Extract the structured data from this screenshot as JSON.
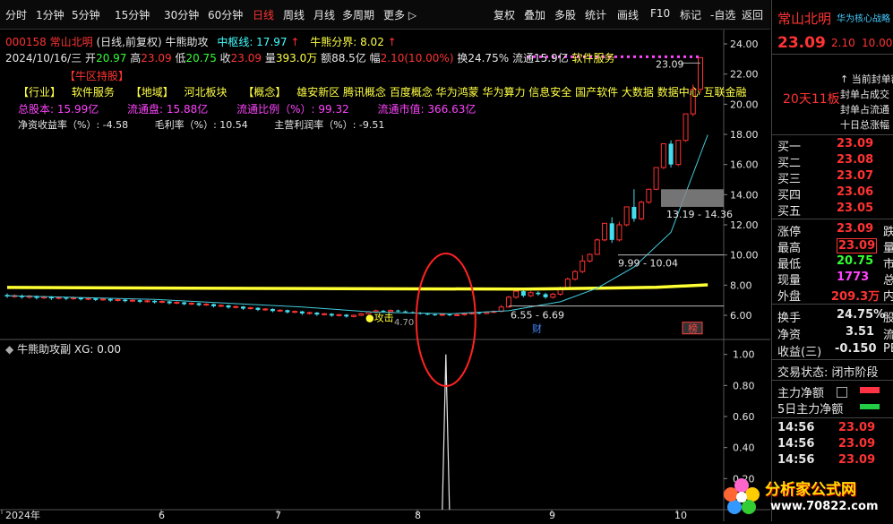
{
  "toolbar": {
    "left_items": [
      "分时",
      "1分钟",
      "5分钟",
      "15分钟",
      "30分钟",
      "60分钟",
      "日线",
      "周线",
      "月线",
      "多周期",
      "更多"
    ],
    "active": "日线",
    "right_items": [
      "复权",
      "叠加",
      "多股",
      "统计",
      "画线",
      "F10",
      "标记",
      "-自选",
      "返回"
    ]
  },
  "info": {
    "code_name": "000158 常山北明",
    "fq": "(日线,前复权)",
    "indicator": "牛熊助攻",
    "pivot_label": "中枢线: 17.97",
    "bull_bear": "牛熊分界: 8.02",
    "date": "2024/10/16/三",
    "open_label": "开",
    "open": "20.97",
    "high_label": "高",
    "high": "23.09",
    "low_label": "低",
    "low": "20.75",
    "close_label": "收",
    "close": "23.09",
    "vol_label": "量",
    "vol": "393.0万",
    "amt_label": "额",
    "amt": "88.5亿",
    "amp_label": "幅",
    "amp": "2.10(10.00%)",
    "turn_label": "换",
    "turn": "24.75%",
    "float_label": "流通",
    "float": "15.9亿",
    "sector": "软件服务"
  },
  "annot": {
    "zone": "【牛区持股】",
    "industry_tag": "【行业】",
    "industry": "软件服务",
    "region_tag": "【地域】",
    "region": "河北板块",
    "concept_tag": "【概念】",
    "concepts": "雄安新区 腾讯概念 百度概念 华为鸿蒙 华为算力 信息安全 国产软件 大数据 数据中心 互联金融",
    "total_share": "总股本: 15.99亿",
    "float_share": "流通盘: 15.88亿",
    "float_ratio": "流通比例（%）: 99.32",
    "float_mv": "流通市值: 366.63亿",
    "roe": "净资收益率（%）: -4.58",
    "gross": "毛利率（%）: 10.54",
    "net": "主营利润率（%）: -9.51"
  },
  "chart_marks": {
    "last_price": "23.09",
    "range1": "13.19 - 14.36",
    "range2": "9.99 - 10.04",
    "range3": "6.55 - 6.69",
    "low_mark": "4.70",
    "fin": "财",
    "rank": "榜",
    "attack": "攻击"
  },
  "sub": {
    "title": "牛熊助攻副 XG: 0.00"
  },
  "chart_data": {
    "type": "line",
    "y_ticks": [
      "24.00",
      "22.00",
      "20.00",
      "18.00",
      "16.00",
      "14.00",
      "12.00",
      "10.00",
      "8.00",
      "6.00"
    ],
    "ylim": [
      5.2,
      24.8
    ],
    "sub_ticks": [
      "1.00",
      "0.80",
      "0.60",
      "0.40",
      "0.20"
    ],
    "sub_ylim": [
      0,
      1.05
    ],
    "x_ticks": [
      "2024年",
      "6",
      "7",
      "8",
      "9",
      "10"
    ],
    "candles": [
      {
        "o": 7.35,
        "c": 7.25,
        "h": 7.45,
        "l": 7.15
      },
      {
        "o": 7.25,
        "c": 7.3,
        "h": 7.4,
        "l": 7.15
      },
      {
        "o": 7.3,
        "c": 7.2,
        "h": 7.38,
        "l": 7.1
      },
      {
        "o": 7.2,
        "c": 7.28,
        "h": 7.35,
        "l": 7.1
      },
      {
        "o": 7.28,
        "c": 7.15,
        "h": 7.32,
        "l": 7.05
      },
      {
        "o": 7.15,
        "c": 7.22,
        "h": 7.3,
        "l": 7.08
      },
      {
        "o": 7.22,
        "c": 7.12,
        "h": 7.28,
        "l": 7.02
      },
      {
        "o": 7.12,
        "c": 7.18,
        "h": 7.26,
        "l": 7.05
      },
      {
        "o": 7.18,
        "c": 7.1,
        "h": 7.22,
        "l": 7.0
      },
      {
        "o": 7.1,
        "c": 7.16,
        "h": 7.24,
        "l": 7.02
      },
      {
        "o": 7.16,
        "c": 7.06,
        "h": 7.2,
        "l": 6.98
      },
      {
        "o": 7.06,
        "c": 7.12,
        "h": 7.2,
        "l": 7.0
      },
      {
        "o": 7.12,
        "c": 7.02,
        "h": 7.16,
        "l": 6.94
      },
      {
        "o": 7.02,
        "c": 7.08,
        "h": 7.15,
        "l": 6.96
      },
      {
        "o": 7.08,
        "c": 6.98,
        "h": 7.12,
        "l": 6.9
      },
      {
        "o": 6.98,
        "c": 7.04,
        "h": 7.1,
        "l": 6.92
      },
      {
        "o": 7.04,
        "c": 6.94,
        "h": 7.08,
        "l": 6.86
      },
      {
        "o": 6.94,
        "c": 7.0,
        "h": 7.06,
        "l": 6.88
      },
      {
        "o": 7.0,
        "c": 6.9,
        "h": 7.04,
        "l": 6.82
      },
      {
        "o": 6.9,
        "c": 6.96,
        "h": 7.02,
        "l": 6.84
      },
      {
        "o": 6.96,
        "c": 6.86,
        "h": 7.0,
        "l": 6.78
      },
      {
        "o": 6.86,
        "c": 6.92,
        "h": 6.98,
        "l": 6.8
      },
      {
        "o": 6.92,
        "c": 6.8,
        "h": 6.95,
        "l": 6.72
      },
      {
        "o": 6.8,
        "c": 6.86,
        "h": 6.92,
        "l": 6.74
      },
      {
        "o": 6.86,
        "c": 6.74,
        "h": 6.9,
        "l": 6.66
      },
      {
        "o": 6.74,
        "c": 6.8,
        "h": 6.86,
        "l": 6.68
      },
      {
        "o": 6.8,
        "c": 6.68,
        "h": 6.84,
        "l": 6.6
      },
      {
        "o": 6.68,
        "c": 6.74,
        "h": 6.8,
        "l": 6.62
      },
      {
        "o": 6.74,
        "c": 6.6,
        "h": 6.78,
        "l": 6.52
      },
      {
        "o": 6.6,
        "c": 6.66,
        "h": 6.72,
        "l": 6.54
      },
      {
        "o": 6.66,
        "c": 6.52,
        "h": 6.7,
        "l": 6.44
      },
      {
        "o": 6.52,
        "c": 6.58,
        "h": 6.64,
        "l": 6.46
      },
      {
        "o": 6.58,
        "c": 6.44,
        "h": 6.62,
        "l": 6.36
      },
      {
        "o": 6.44,
        "c": 6.5,
        "h": 6.56,
        "l": 6.38
      },
      {
        "o": 6.5,
        "c": 6.36,
        "h": 6.54,
        "l": 6.28
      },
      {
        "o": 6.36,
        "c": 6.42,
        "h": 6.48,
        "l": 6.3
      },
      {
        "o": 6.42,
        "c": 6.28,
        "h": 6.46,
        "l": 6.2
      },
      {
        "o": 6.28,
        "c": 6.34,
        "h": 6.4,
        "l": 6.22
      },
      {
        "o": 6.34,
        "c": 6.2,
        "h": 6.38,
        "l": 6.12
      },
      {
        "o": 6.2,
        "c": 6.26,
        "h": 6.32,
        "l": 6.14
      },
      {
        "o": 6.26,
        "c": 6.12,
        "h": 6.3,
        "l": 6.02
      },
      {
        "o": 6.12,
        "c": 6.18,
        "h": 6.24,
        "l": 6.05
      },
      {
        "o": 6.18,
        "c": 6.05,
        "h": 6.22,
        "l": 5.96
      },
      {
        "o": 6.05,
        "c": 6.1,
        "h": 6.16,
        "l": 5.98
      },
      {
        "o": 6.1,
        "c": 5.98,
        "h": 6.14,
        "l": 5.9
      },
      {
        "o": 5.98,
        "c": 6.04,
        "h": 6.1,
        "l": 5.92
      },
      {
        "o": 6.04,
        "c": 5.92,
        "h": 6.08,
        "l": 5.84
      },
      {
        "o": 5.92,
        "c": 6.0,
        "h": 6.06,
        "l": 5.86
      },
      {
        "o": 6.0,
        "c": 6.1,
        "h": 6.16,
        "l": 5.94
      },
      {
        "o": 6.1,
        "c": 6.22,
        "h": 6.28,
        "l": 6.04
      },
      {
        "o": 6.22,
        "c": 6.3,
        "h": 6.38,
        "l": 6.14
      },
      {
        "o": 6.3,
        "c": 6.24,
        "h": 6.36,
        "l": 6.18
      },
      {
        "o": 6.24,
        "c": 6.32,
        "h": 6.4,
        "l": 6.18
      },
      {
        "o": 6.32,
        "c": 6.26,
        "h": 6.38,
        "l": 6.2
      },
      {
        "o": 6.26,
        "c": 6.2,
        "h": 6.32,
        "l": 6.14
      },
      {
        "o": 6.2,
        "c": 6.16,
        "h": 6.26,
        "l": 6.1
      },
      {
        "o": 6.16,
        "c": 6.1,
        "h": 6.22,
        "l": 6.04
      },
      {
        "o": 6.1,
        "c": 6.06,
        "h": 6.16,
        "l": 6.0
      },
      {
        "o": 6.06,
        "c": 6.02,
        "h": 6.12,
        "l": 5.96
      },
      {
        "o": 6.02,
        "c": 6.06,
        "h": 6.12,
        "l": 5.96
      },
      {
        "o": 6.06,
        "c": 6.0,
        "h": 6.1,
        "l": 5.94
      },
      {
        "o": 6.0,
        "c": 6.04,
        "h": 6.1,
        "l": 5.94
      },
      {
        "o": 6.04,
        "c": 6.1,
        "h": 6.16,
        "l": 5.98
      },
      {
        "o": 6.1,
        "c": 6.16,
        "h": 6.22,
        "l": 6.04
      },
      {
        "o": 6.16,
        "c": 6.12,
        "h": 6.22,
        "l": 6.06
      },
      {
        "o": 6.12,
        "c": 6.2,
        "h": 6.26,
        "l": 6.06
      },
      {
        "o": 6.2,
        "c": 6.26,
        "h": 6.32,
        "l": 6.14
      },
      {
        "o": 6.26,
        "c": 6.55,
        "h": 6.69,
        "l": 6.2
      },
      {
        "o": 6.55,
        "c": 7.2,
        "h": 7.3,
        "l": 6.5
      },
      {
        "o": 7.2,
        "c": 7.6,
        "h": 7.7,
        "l": 7.1
      },
      {
        "o": 7.6,
        "c": 7.3,
        "h": 7.7,
        "l": 7.2
      },
      {
        "o": 7.3,
        "c": 7.5,
        "h": 7.6,
        "l": 7.2
      },
      {
        "o": 7.5,
        "c": 7.4,
        "h": 7.6,
        "l": 7.3
      },
      {
        "o": 7.4,
        "c": 7.2,
        "h": 7.5,
        "l": 7.1
      },
      {
        "o": 7.2,
        "c": 7.4,
        "h": 7.5,
        "l": 7.1
      },
      {
        "o": 7.4,
        "c": 7.8,
        "h": 7.9,
        "l": 7.3
      },
      {
        "o": 7.8,
        "c": 8.4,
        "h": 8.5,
        "l": 7.7
      },
      {
        "o": 8.4,
        "c": 8.9,
        "h": 9.0,
        "l": 8.3
      },
      {
        "o": 8.9,
        "c": 9.6,
        "h": 9.99,
        "l": 8.8
      },
      {
        "o": 9.6,
        "c": 10.04,
        "h": 10.1,
        "l": 9.5
      },
      {
        "o": 10.04,
        "c": 11.0,
        "h": 11.1,
        "l": 10.0
      },
      {
        "o": 11.0,
        "c": 12.1,
        "h": 12.1,
        "l": 10.9
      },
      {
        "o": 12.1,
        "c": 11.0,
        "h": 12.5,
        "l": 10.8
      },
      {
        "o": 11.0,
        "c": 12.0,
        "h": 12.2,
        "l": 10.9
      },
      {
        "o": 12.0,
        "c": 13.19,
        "h": 13.19,
        "l": 11.9
      },
      {
        "o": 13.19,
        "c": 12.4,
        "h": 14.36,
        "l": 12.2
      },
      {
        "o": 12.4,
        "c": 13.5,
        "h": 13.6,
        "l": 12.3
      },
      {
        "o": 13.5,
        "c": 14.36,
        "h": 14.4,
        "l": 13.4
      },
      {
        "o": 14.36,
        "c": 15.8,
        "h": 15.8,
        "l": 14.3
      },
      {
        "o": 15.8,
        "c": 17.38,
        "h": 17.38,
        "l": 15.7
      },
      {
        "o": 17.38,
        "c": 16.0,
        "h": 17.6,
        "l": 15.8
      },
      {
        "o": 16.0,
        "c": 17.6,
        "h": 17.6,
        "l": 15.9
      },
      {
        "o": 17.6,
        "c": 19.36,
        "h": 19.36,
        "l": 17.5
      },
      {
        "o": 19.36,
        "c": 20.99,
        "h": 21.3,
        "l": 19.2
      },
      {
        "o": 20.99,
        "c": 23.09,
        "h": 23.09,
        "l": 20.75
      }
    ],
    "yellow_line": [
      {
        "i": 0,
        "v": 7.85
      },
      {
        "i": 25,
        "v": 7.8
      },
      {
        "i": 50,
        "v": 7.76
      },
      {
        "i": 70,
        "v": 7.74
      },
      {
        "i": 80,
        "v": 7.8
      },
      {
        "i": 88,
        "v": 7.86
      },
      {
        "i": 95,
        "v": 8.02
      }
    ],
    "cyan_ma": [
      {
        "i": 0,
        "v": 7.3
      },
      {
        "i": 20,
        "v": 7.05
      },
      {
        "i": 40,
        "v": 6.55
      },
      {
        "i": 50,
        "v": 6.2
      },
      {
        "i": 60,
        "v": 6.1
      },
      {
        "i": 68,
        "v": 6.3
      },
      {
        "i": 75,
        "v": 6.9
      },
      {
        "i": 80,
        "v": 7.8
      },
      {
        "i": 85,
        "v": 9.2
      },
      {
        "i": 90,
        "v": 11.5
      },
      {
        "i": 95,
        "v": 17.97
      }
    ],
    "signal": [
      {
        "i": 59,
        "v": 1.0
      }
    ]
  },
  "right": {
    "name": "常山北明",
    "concept_tag": "华为核心战略",
    "price": "23.09",
    "change": "2.10",
    "pct": "10.00",
    "limit_text": "20天11板",
    "notes": [
      "↑ 当前封单额",
      "封单占成交",
      "封单占流通",
      "十日总涨幅"
    ],
    "order_book": [
      {
        "label": "买一",
        "price": "23.09"
      },
      {
        "label": "买二",
        "price": "23.08"
      },
      {
        "label": "买三",
        "price": "23.07"
      },
      {
        "label": "买四",
        "price": "23.06"
      },
      {
        "label": "买五",
        "price": "23.05"
      }
    ],
    "stats": [
      {
        "label": "涨停",
        "value": "23.09",
        "tail": "跌"
      },
      {
        "label": "最高",
        "value": "23.09",
        "tail": "量"
      },
      {
        "label": "最低",
        "value": "20.75",
        "tail": "市"
      },
      {
        "label": "现量",
        "value": "1773",
        "tail": "总"
      },
      {
        "label": "外盘",
        "value": "209.3万",
        "tail": "内"
      }
    ],
    "stats2": [
      {
        "label": "换手",
        "value": "24.75%",
        "tail": "股"
      },
      {
        "label": "净资",
        "value": "3.51",
        "tail": "流"
      },
      {
        "label": "收益(三)",
        "value": "-0.150",
        "tail": "PE"
      }
    ],
    "trade_status": "交易状态: 闭市阶段",
    "main_flow": "主力净额",
    "main_flow5": "5日主力净额",
    "ticks": [
      {
        "time": "14:56",
        "price": "23.09"
      },
      {
        "time": "14:56",
        "price": "23.09"
      },
      {
        "time": "14:56",
        "price": "23.09"
      }
    ],
    "watermark_brand": "分析家公式网",
    "watermark_url": "www.70822.com"
  }
}
